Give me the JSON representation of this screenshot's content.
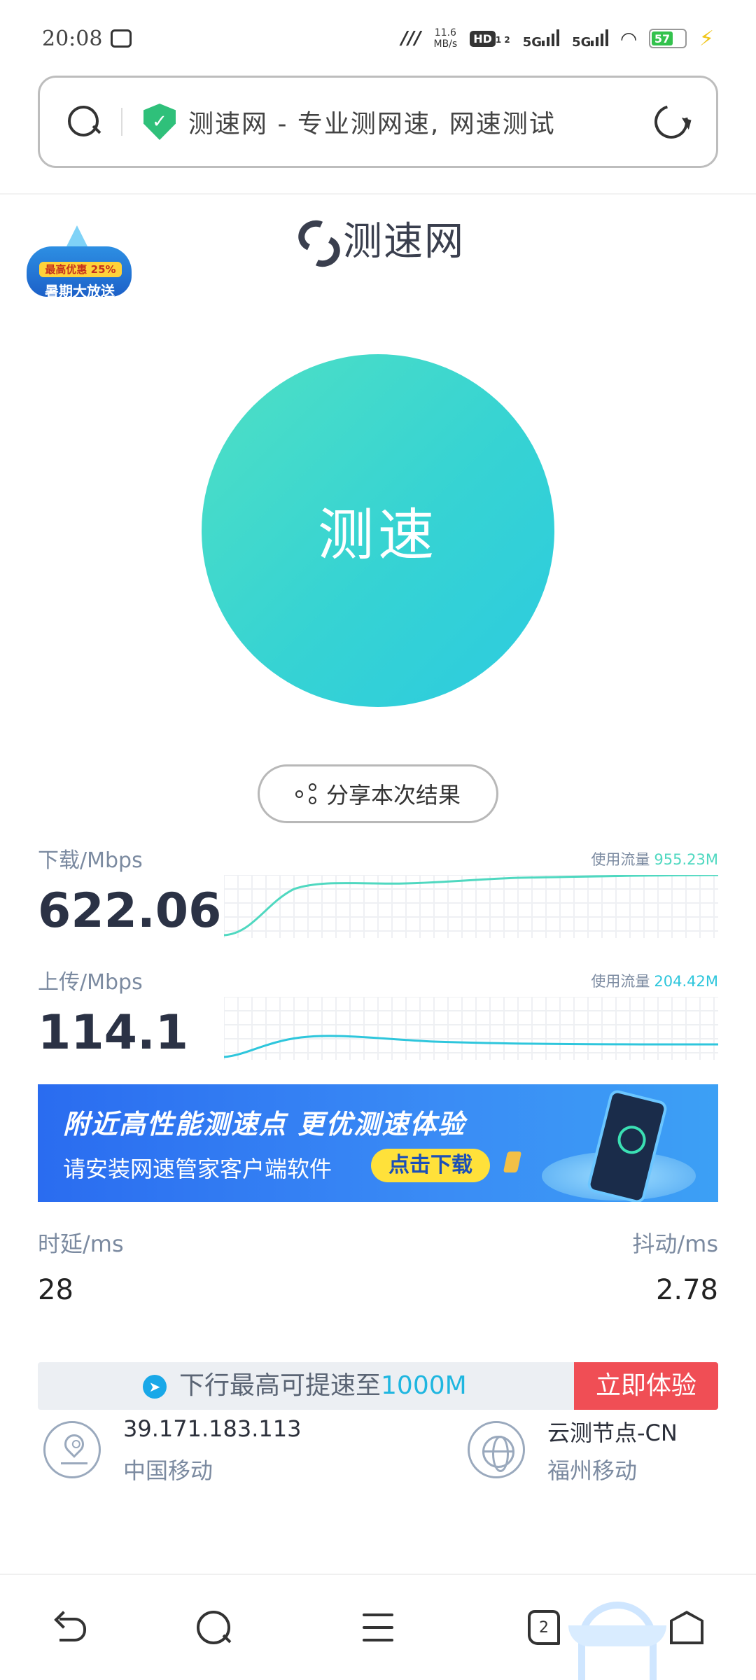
{
  "status_bar": {
    "time": "20:08",
    "net_speed_value": "11.6",
    "net_speed_unit": "MB/s",
    "hd_label": "HD",
    "hd_sub": "1 2",
    "sim1": "5G",
    "sim2": "5G",
    "battery": "57"
  },
  "address_bar": {
    "page_title": "测速网 - 专业测网速, 网速测试"
  },
  "promo_badge": {
    "top_text": "最高优惠 25%",
    "main_text": "暑期大放送"
  },
  "logo": {
    "text": "测速网"
  },
  "speed_test": {
    "button_label": "测速"
  },
  "share": {
    "label": "分享本次结果"
  },
  "download": {
    "label": "下载/Mbps",
    "value": "622.06",
    "usage_label": "使用流量",
    "usage_value": "955.23M",
    "color": "#4fd8c0"
  },
  "upload": {
    "label": "上传/Mbps",
    "value": "114.1",
    "usage_label": "使用流量",
    "usage_value": "204.42M",
    "color": "#2ec6dc"
  },
  "ad_banner": {
    "headline": "附近高性能测速点  更优测速体验",
    "subtext": "请安装网速管家客户端软件",
    "button": "点击下载"
  },
  "latency": {
    "label": "时延/ms",
    "value": "28"
  },
  "jitter": {
    "label": "抖动/ms",
    "value": "2.78"
  },
  "upgrade": {
    "text": "下行最高可提速至",
    "highlight": "1000M",
    "button": "立即体验"
  },
  "ip_info": {
    "ip": "39.171.183.113",
    "isp": "中国移动"
  },
  "node_info": {
    "name": "云测节点-CN",
    "isp": "福州移动"
  },
  "bottom_nav": {
    "tab_count": "2"
  },
  "colors": {
    "accent_teal": "#36d3d3",
    "accent_blue": "#1fb6e0",
    "cta_red": "#f04e55"
  }
}
